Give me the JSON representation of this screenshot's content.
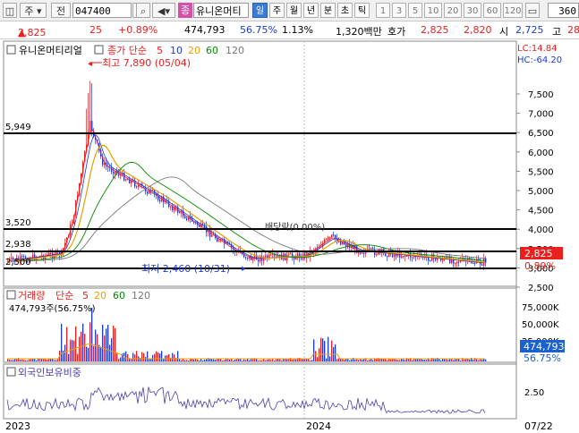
{
  "toolbar": {
    "market_label": "주",
    "type_label": "전",
    "code_value": "047400",
    "name_badge": "종",
    "stock_name": "유니온머티",
    "periods": [
      "일",
      "주",
      "월",
      "년",
      "분",
      "초",
      "틱"
    ],
    "active_period": "일",
    "intervals": [
      "1",
      "3",
      "5",
      "10",
      "20",
      "30",
      "60",
      "120"
    ],
    "count_value": "360"
  },
  "quote": {
    "price": "2,825",
    "change": "25",
    "change_pct": "+0.89%",
    "volume": "474,793",
    "volume_ratio": "56.75%",
    "turnover_pct": "1.13%",
    "amount": "1,320백만",
    "bid_label": "호가",
    "ask_price": "2,825",
    "bid_price": "2,820",
    "open_label": "시",
    "open_price": "2,725",
    "high_label": "고",
    "high_price": "28"
  },
  "price_panel": {
    "legend_name": "유니온머티리얼",
    "legend_ma": "종가 단순",
    "ma_periods": [
      "5",
      "10",
      "20",
      "60",
      "120"
    ],
    "ma_colors": [
      "#e8201e",
      "#1a3cd0",
      "#e8a000",
      "#008a00",
      "#777777"
    ],
    "lc_label": "LC:14.84",
    "hc_label": "HC:-64.20",
    "max_label": "최고 7,890 (05/04)",
    "min_label": "최저 2,460 (10/31)",
    "ann_label": "배당락(0.00%)",
    "hlines": [
      "5,949",
      "3,520",
      "2,938",
      "2,500"
    ],
    "last_price_tag": "2,825",
    "last_pct_tag": "0.89%",
    "y_ticks": [
      "7,500",
      "7,000",
      "6,500",
      "6,000",
      "5,500",
      "5,000",
      "4,500",
      "4,000",
      "3,500",
      "3,000",
      "2,500"
    ]
  },
  "volume_panel": {
    "legend_name": "거래량",
    "legend_ma": "단순",
    "ma_periods": [
      "5",
      "20",
      "60",
      "120"
    ],
    "ma_colors": [
      "#e8201e",
      "#e8a000",
      "#008a00",
      "#777777"
    ],
    "value_label": "474,793주(56.75%)",
    "y_ticks": [
      "75,000K",
      "50,000K",
      "25,000K"
    ],
    "vol_tag": "474,793",
    "vol_pct_tag": "56.75%"
  },
  "foreign_panel": {
    "legend_name": "외국인보유비중",
    "y_tick": "2.50"
  },
  "x_axis": {
    "labels": [
      "2023",
      "2024",
      "07/22"
    ]
  },
  "colors": {
    "up": "#e8201e",
    "down": "#1a3cd0",
    "tag_red": "#e8201e",
    "tag_blue": "#1a60d0"
  }
}
